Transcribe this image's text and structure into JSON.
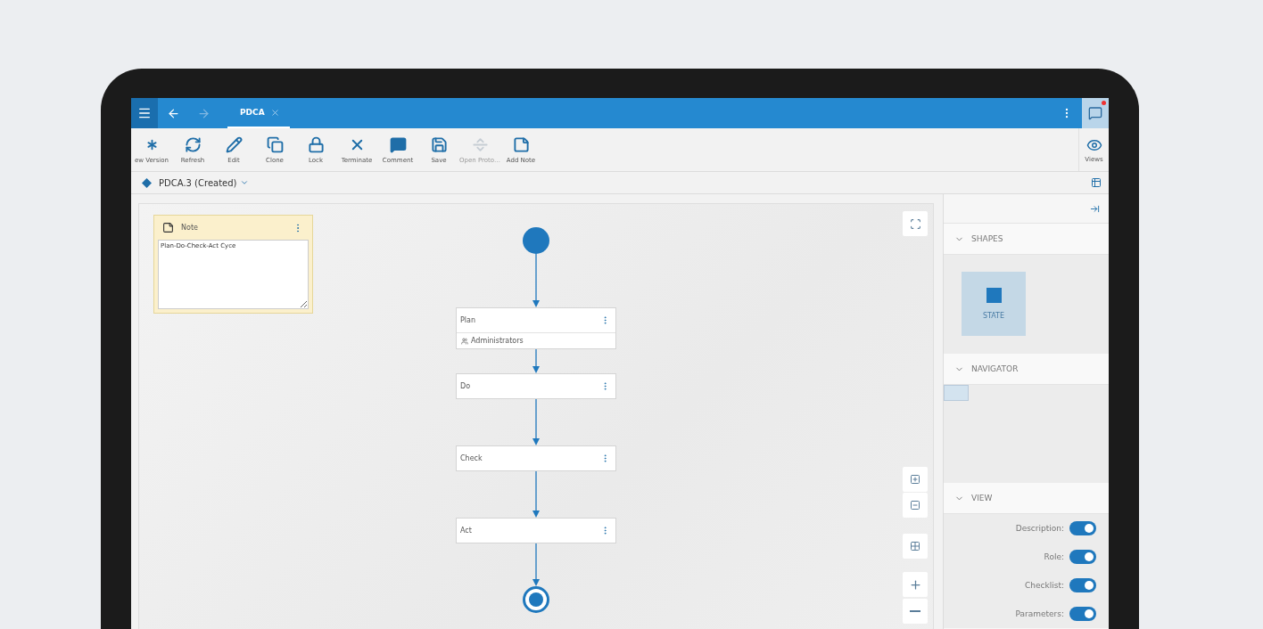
{
  "topbar": {
    "tabs": [
      {
        "label": "PDCA",
        "selected": true
      }
    ]
  },
  "toolbar": {
    "tools": [
      {
        "label": "ew Version",
        "disabled": false
      },
      {
        "label": "Refresh",
        "disabled": false
      },
      {
        "label": "Edit",
        "disabled": false
      },
      {
        "label": "Clone",
        "disabled": false
      },
      {
        "label": "Lock",
        "disabled": false
      },
      {
        "label": "Terminate",
        "disabled": false
      },
      {
        "label": "Comment",
        "disabled": false
      },
      {
        "label": "Save",
        "disabled": false
      },
      {
        "label": "Open Proto…",
        "disabled": true
      },
      {
        "label": "Add Note",
        "disabled": false
      }
    ],
    "views": {
      "label": "Views"
    }
  },
  "breadcrumb": {
    "title": "PDCA.3",
    "status": "(Created)"
  },
  "note": {
    "title": "Note",
    "text": "Plan-Do-Check-Act Cyce"
  },
  "diagram": {
    "nodes": [
      {
        "kind": "start"
      },
      {
        "kind": "state",
        "label": "Plan",
        "role": "Administrators"
      },
      {
        "kind": "state",
        "label": "Do"
      },
      {
        "kind": "state",
        "label": "Check"
      },
      {
        "kind": "state",
        "label": "Act"
      },
      {
        "kind": "end"
      }
    ]
  },
  "panel": {
    "shapes": {
      "title": "SHAPES",
      "items": [
        {
          "label": "STATE"
        }
      ]
    },
    "navigator": {
      "title": "NAVIGATOR"
    },
    "view": {
      "title": "VIEW",
      "toggles": [
        {
          "label": "Description:",
          "on": true
        },
        {
          "label": "Role:",
          "on": true
        },
        {
          "label": "Checklist:",
          "on": true
        },
        {
          "label": "Parameters:",
          "on": true
        }
      ]
    }
  }
}
